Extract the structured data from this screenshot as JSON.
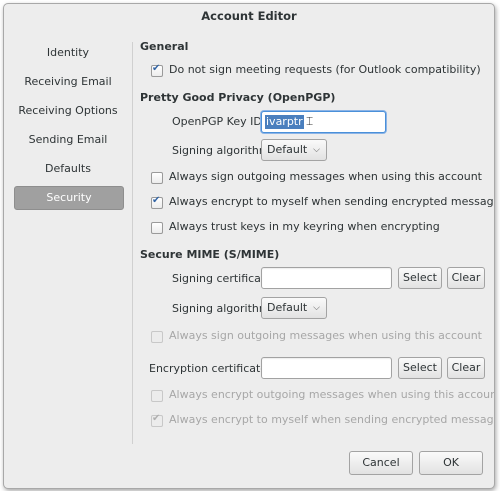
{
  "window": {
    "title": "Account Editor"
  },
  "sidebar": {
    "items": [
      {
        "label": "Identity"
      },
      {
        "label": "Receiving Email"
      },
      {
        "label": "Receiving Options"
      },
      {
        "label": "Sending Email"
      },
      {
        "label": "Defaults"
      },
      {
        "label": "Security",
        "selected": true
      }
    ]
  },
  "general": {
    "heading": "General",
    "no_sign_meeting": {
      "label": "Do not sign meeting requests (for Outlook compatibility)",
      "checked": true
    }
  },
  "pgp": {
    "heading": "Pretty Good Privacy (OpenPGP)",
    "key_id_label": "OpenPGP Key ID:",
    "key_id_value": "ivarptr",
    "signing_label": "Signing algorithm:",
    "signing_value": "Default",
    "always_sign": {
      "label": "Always sign outgoing messages when using this account",
      "checked": false
    },
    "encrypt_self": {
      "label": "Always encrypt to myself when sending encrypted messages",
      "checked": true
    },
    "trust_keys": {
      "label": "Always trust keys in my keyring when encrypting",
      "checked": false
    }
  },
  "smime": {
    "heading": "Secure MIME (S/MIME)",
    "signing_cert_label": "Signing certificate:",
    "signing_cert_value": "",
    "select_label": "Select",
    "clear_label": "Clear",
    "signing_label": "Signing algorithm:",
    "signing_value": "Default",
    "always_sign": {
      "label": "Always sign outgoing messages when using this account",
      "checked": false
    },
    "encryption_cert_label": "Encryption certificate:",
    "encryption_cert_value": "",
    "always_encrypt": {
      "label": "Always encrypt outgoing messages when using this account",
      "checked": false
    },
    "encrypt_self": {
      "label": "Always encrypt to myself when sending encrypted messages",
      "checked": true
    }
  },
  "footer": {
    "cancel_label": "Cancel",
    "ok_label": "OK"
  }
}
